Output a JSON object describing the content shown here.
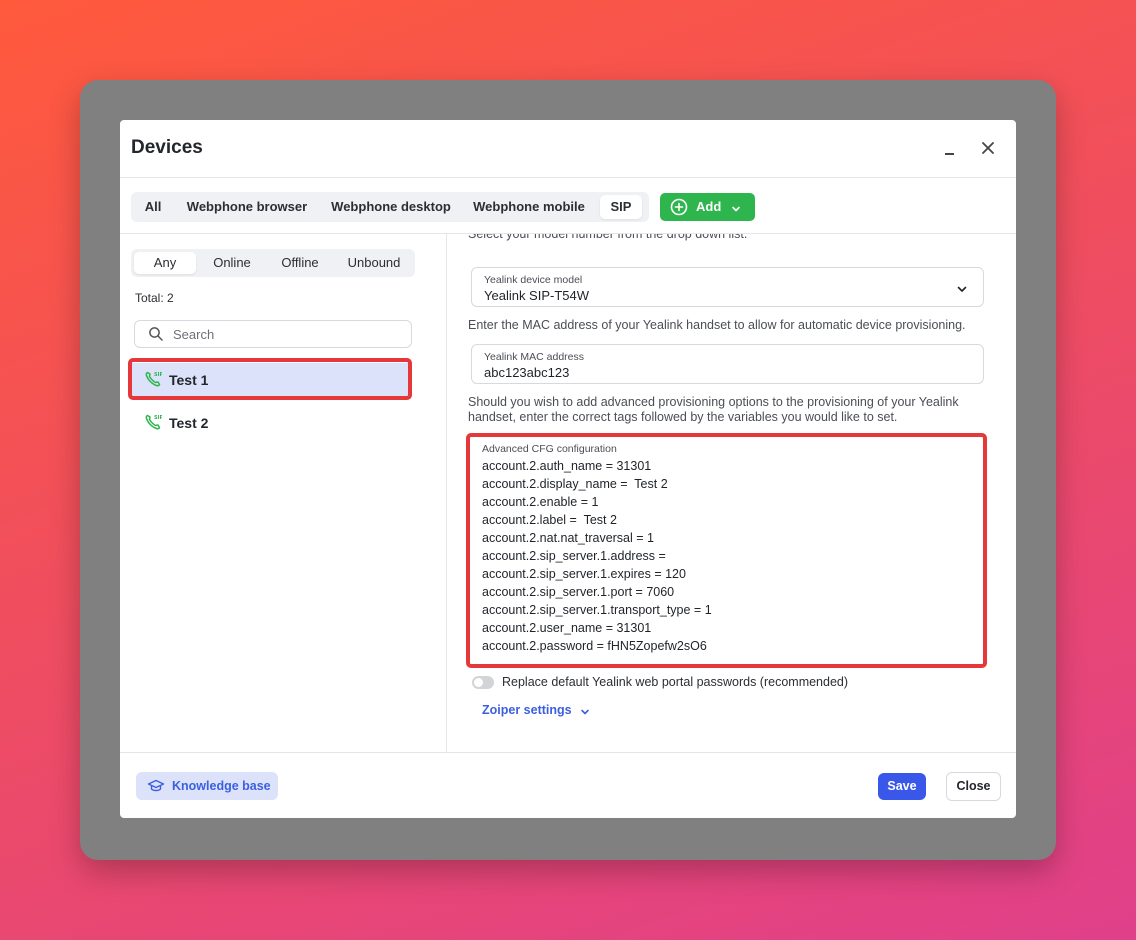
{
  "dialog": {
    "title": "Devices"
  },
  "tabs": [
    {
      "label": "All"
    },
    {
      "label": "Webphone browser"
    },
    {
      "label": "Webphone desktop"
    },
    {
      "label": "Webphone mobile"
    },
    {
      "label": "SIP",
      "active": true
    }
  ],
  "add_button": {
    "label": "Add"
  },
  "status_filters": [
    {
      "label": "Any",
      "active": true
    },
    {
      "label": "Online"
    },
    {
      "label": "Offline"
    },
    {
      "label": "Unbound"
    }
  ],
  "total": "Total: 2",
  "search": {
    "placeholder": "Search",
    "value": ""
  },
  "devices": [
    {
      "name": "Test 1",
      "selected": true
    },
    {
      "name": "Test 2",
      "selected": false
    }
  ],
  "form": {
    "model_note": "Select your model number from the drop down list.",
    "model_label": "Yealink device model",
    "model_value": "Yealink SIP-T54W",
    "mac_note": "Enter the MAC address of your Yealink handset to allow for automatic device provisioning.",
    "mac_label": "Yealink MAC address",
    "mac_value": "abc123abc123",
    "advanced_note_line1": "Should you wish to add advanced provisioning options to the provisioning of your Yealink",
    "advanced_note_line2": "handset, enter the correct tags followed by the variables you would like to set.",
    "cfg_label": "Advanced CFG configuration",
    "cfg_lines": [
      "account.2.auth_name = 31301",
      "account.2.display_name =  Test 2",
      "account.2.enable = 1",
      "account.2.label =  Test 2",
      "account.2.nat.nat_traversal = 1",
      "account.2.sip_server.1.address = ",
      "account.2.sip_server.1.expires = 120",
      "account.2.sip_server.1.port = 7060",
      "account.2.sip_server.1.transport_type = 1",
      "account.2.user_name = 31301",
      "account.2.password = fHN5Zopefw2sO6"
    ],
    "toggle_label": "Replace default Yealink web portal passwords (recommended)",
    "toggle_on": false,
    "zoiper_label": "Zoiper settings"
  },
  "footer": {
    "knowledge_base": "Knowledge base",
    "save": "Save",
    "close": "Close"
  },
  "colors": {
    "accent": "#3957e8",
    "add_green": "#2fb54e",
    "highlight_red": "#e5383b",
    "selected_row": "#dde2fb"
  }
}
